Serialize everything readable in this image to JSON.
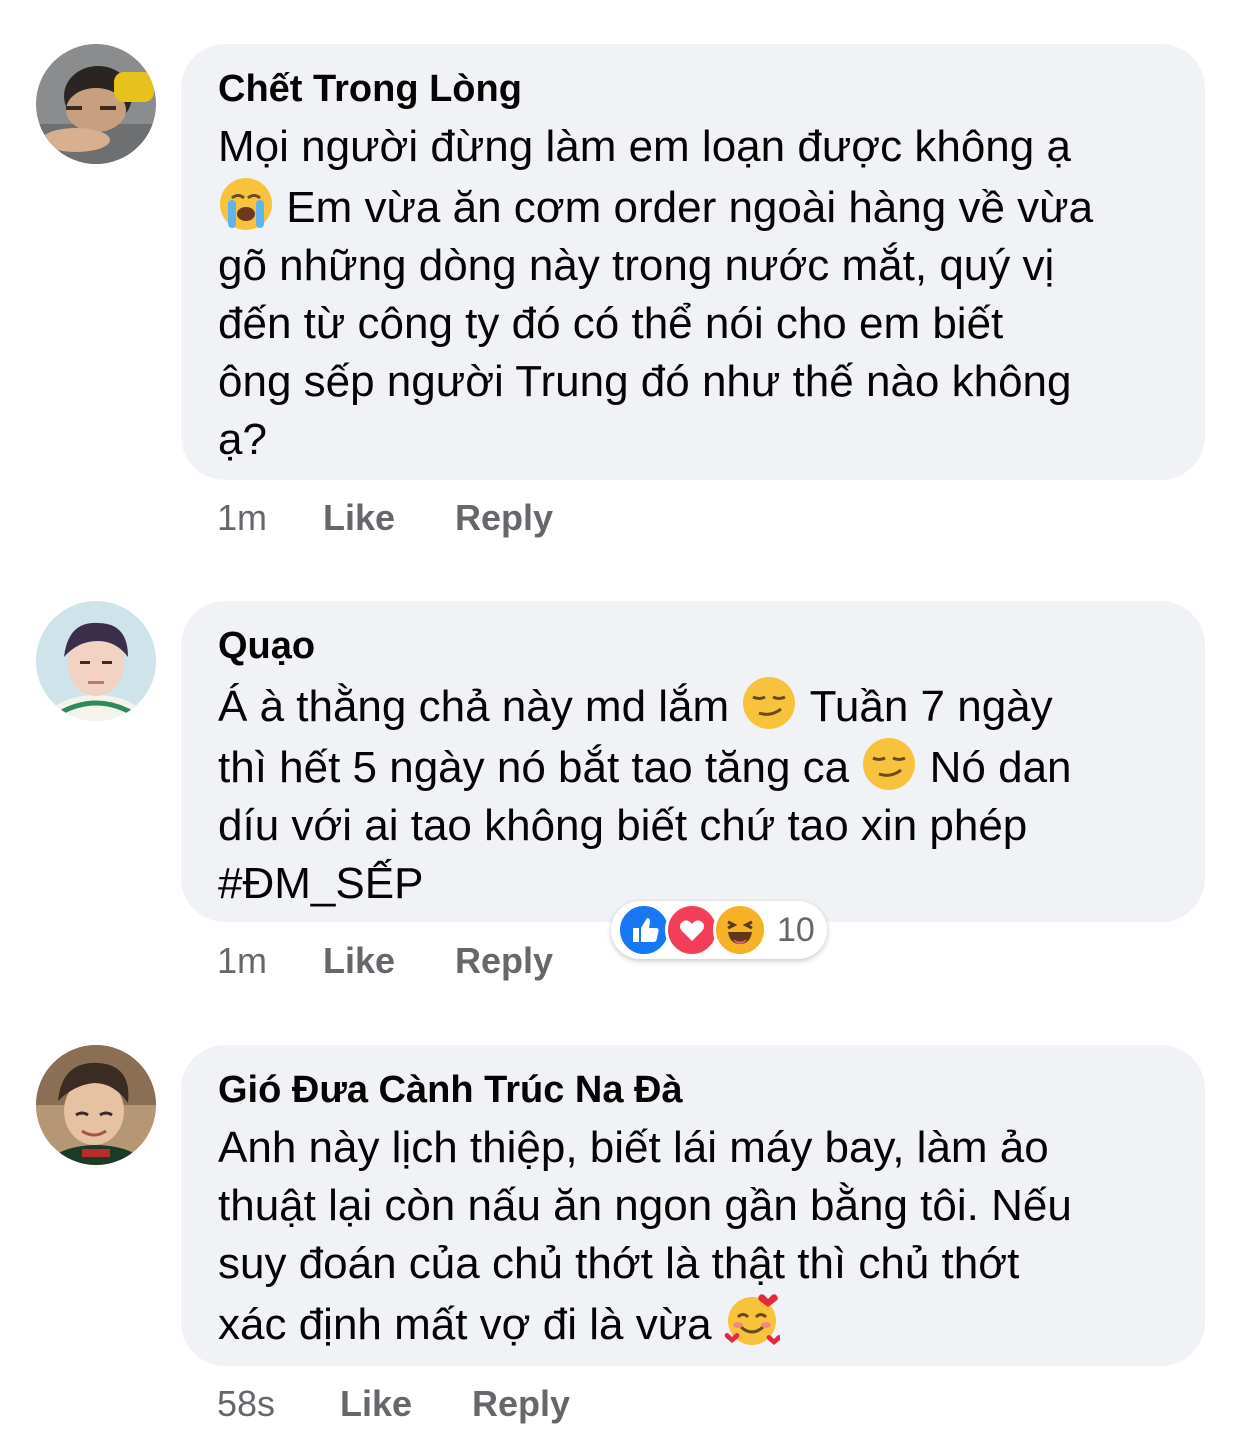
{
  "comments": [
    {
      "author": "Chết Trong Lòng",
      "lines": [
        "Mọi người đừng làm em loạn được không ạ",
        "Em vừa ăn cơm order ngoài hàng về vừa",
        "gõ những dòng này trong nước mắt, quý vị",
        "đến từ công ty đó có thể nói cho em biết",
        "ông sếp người Trung đó như thế nào không",
        "ạ?"
      ],
      "emoji": "loudly-crying-face-icon",
      "time": "1m",
      "like_label": "Like",
      "reply_label": "Reply"
    },
    {
      "author": "Quạo",
      "lines": [
        "Á à thằng chả này md lắm",
        "Tuần 7 ngày",
        "thì hết 5 ngày nó bắt tao tăng ca",
        "Nó dan",
        "díu với ai tao không biết chứ tao xin phép",
        "#ĐM_SẾP"
      ],
      "emoji": "smirking-face-icon",
      "time": "1m",
      "like_label": "Like",
      "reply_label": "Reply",
      "reactions": {
        "icons": [
          "like-reaction-icon",
          "love-reaction-icon",
          "haha-reaction-icon"
        ],
        "count": "10"
      }
    },
    {
      "author": "Gió Đưa Cành Trúc Na Đà",
      "lines": [
        "Anh này lịch thiệp, biết lái máy bay, làm ảo",
        "thuật lại còn nấu ăn ngon gần bằng tôi. Nếu",
        "suy đoán của chủ thớt là thật thì chủ thớt",
        "xác định mất vợ đi là vừa"
      ],
      "emoji": "smiling-face-with-hearts-icon",
      "time": "58s",
      "like_label": "Like",
      "reply_label": "Reply"
    }
  ],
  "colors": {
    "bubble": "#f0f2f5",
    "meta_text": "#65676b",
    "like_blue": "#1877f2",
    "love_red": "#f33e58",
    "haha_yellow": "#f7b125"
  }
}
